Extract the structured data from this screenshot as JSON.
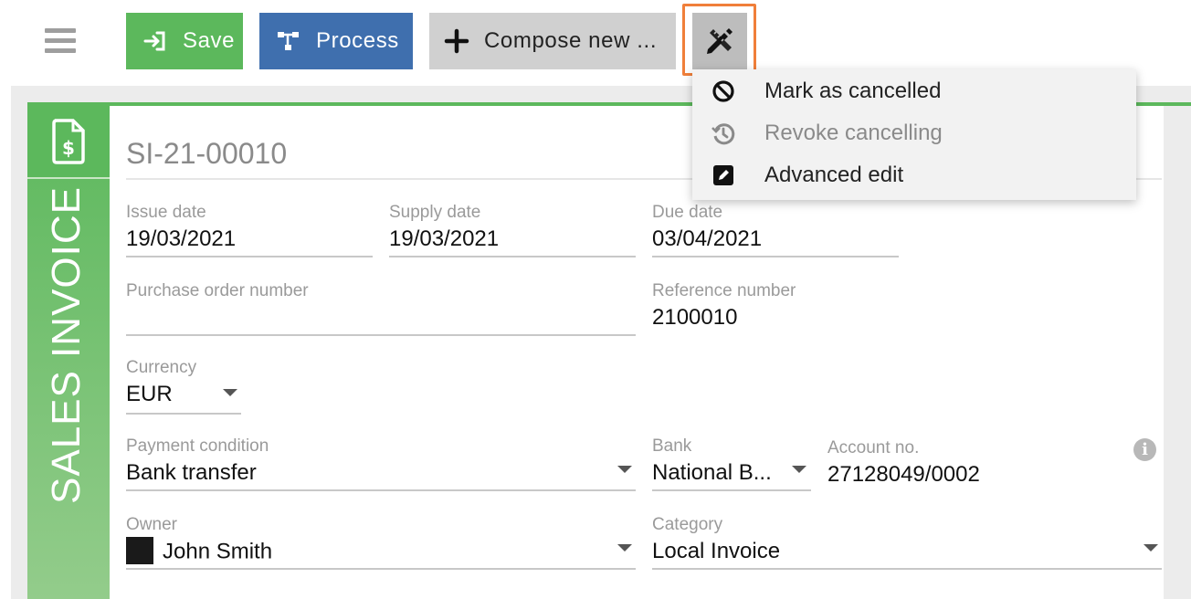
{
  "toolbar": {
    "menu_icon": "hamburger-icon",
    "save_label": "Save",
    "save_icon": "sign-in-icon",
    "process_label": "Process",
    "process_icon": "sitemap-icon",
    "compose_label": "Compose new ...",
    "compose_icon": "plus-icon",
    "tools_icon": "pencil-ruler-icon"
  },
  "menu": {
    "items": [
      {
        "label": "Mark as cancelled",
        "icon": "ban-icon",
        "enabled": true
      },
      {
        "label": "Revoke cancelling",
        "icon": "history-icon",
        "enabled": false
      },
      {
        "label": "Advanced edit",
        "icon": "edit-icon",
        "enabled": true
      }
    ]
  },
  "document": {
    "type_label": "SALES INVOICE",
    "type_icon": "invoice-dollar-icon",
    "number": "SI-21-00010",
    "issue_date": {
      "label": "Issue date",
      "value": "19/03/2021"
    },
    "supply_date": {
      "label": "Supply date",
      "value": "19/03/2021"
    },
    "due_date": {
      "label": "Due date",
      "value": "03/04/2021"
    },
    "purchase_order": {
      "label": "Purchase order number",
      "value": ""
    },
    "reference": {
      "label": "Reference number",
      "value": "2100010"
    },
    "currency": {
      "label": "Currency",
      "value": "EUR"
    },
    "payment_condition": {
      "label": "Payment condition",
      "value": "Bank transfer"
    },
    "bank": {
      "label": "Bank",
      "value": "National B..."
    },
    "account": {
      "label": "Account no.",
      "value": "27128049/0002"
    },
    "owner": {
      "label": "Owner",
      "value": "John Smith"
    },
    "category": {
      "label": "Category",
      "value": "Local Invoice"
    }
  },
  "colors": {
    "save": "#5cb85c",
    "process": "#3f6fae",
    "compose": "#d0d0d0",
    "highlight": "#f07f3a",
    "side": "#5cb85c"
  }
}
